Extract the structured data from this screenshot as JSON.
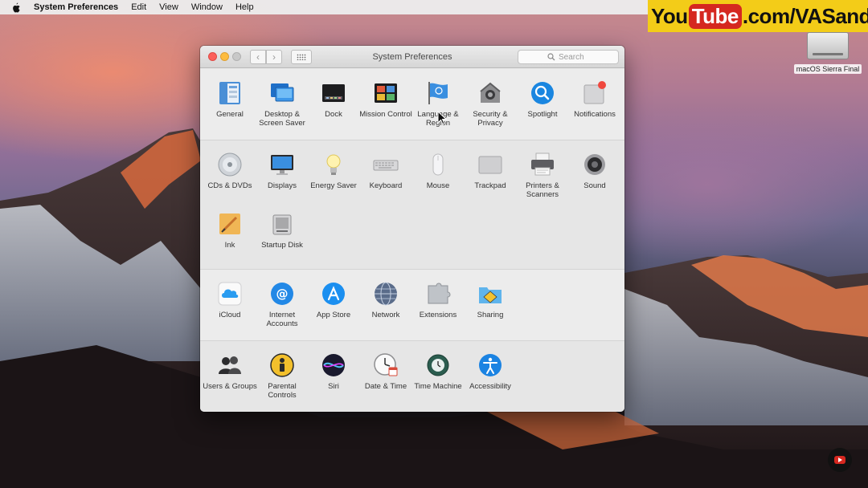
{
  "menubar": {
    "items": [
      "System Preferences",
      "Edit",
      "View",
      "Window",
      "Help"
    ]
  },
  "banner": {
    "you": "You",
    "tube": "Tube",
    "rest": ".com/VASandMore"
  },
  "desktop_icon": {
    "label": "macOS Sierra Final"
  },
  "window": {
    "title": "System Preferences",
    "search_placeholder": "Search"
  },
  "sections": {
    "personal": [
      {
        "label": "General",
        "icon": "general-icon"
      },
      {
        "label": "Desktop & Screen Saver",
        "icon": "desktop-screensaver-icon"
      },
      {
        "label": "Dock",
        "icon": "dock-icon"
      },
      {
        "label": "Mission Control",
        "icon": "mission-control-icon"
      },
      {
        "label": "Language & Region",
        "icon": "language-region-icon"
      },
      {
        "label": "Security & Privacy",
        "icon": "security-icon"
      },
      {
        "label": "Spotlight",
        "icon": "spotlight-icon"
      },
      {
        "label": "Notifications",
        "icon": "notifications-icon"
      }
    ],
    "hardware": [
      {
        "label": "CDs & DVDs",
        "icon": "cd-icon"
      },
      {
        "label": "Displays",
        "icon": "displays-icon"
      },
      {
        "label": "Energy Saver",
        "icon": "energy-saver-icon"
      },
      {
        "label": "Keyboard",
        "icon": "keyboard-icon"
      },
      {
        "label": "Mouse",
        "icon": "mouse-icon"
      },
      {
        "label": "Trackpad",
        "icon": "trackpad-icon"
      },
      {
        "label": "Printers & Scanners",
        "icon": "printer-icon"
      },
      {
        "label": "Sound",
        "icon": "sound-icon"
      },
      {
        "label": "Ink",
        "icon": "ink-icon"
      },
      {
        "label": "Startup Disk",
        "icon": "startup-disk-icon"
      }
    ],
    "internet": [
      {
        "label": "iCloud",
        "icon": "icloud-icon"
      },
      {
        "label": "Internet Accounts",
        "icon": "internet-accounts-icon"
      },
      {
        "label": "App Store",
        "icon": "app-store-icon"
      },
      {
        "label": "Network",
        "icon": "network-icon"
      },
      {
        "label": "Extensions",
        "icon": "extensions-icon"
      },
      {
        "label": "Sharing",
        "icon": "sharing-icon"
      }
    ],
    "system": [
      {
        "label": "Users & Groups",
        "icon": "users-groups-icon"
      },
      {
        "label": "Parental Controls",
        "icon": "parental-controls-icon"
      },
      {
        "label": "Siri",
        "icon": "siri-icon"
      },
      {
        "label": "Date & Time",
        "icon": "date-time-icon"
      },
      {
        "label": "Time Machine",
        "icon": "time-machine-icon"
      },
      {
        "label": "Accessibility",
        "icon": "accessibility-icon"
      }
    ]
  }
}
